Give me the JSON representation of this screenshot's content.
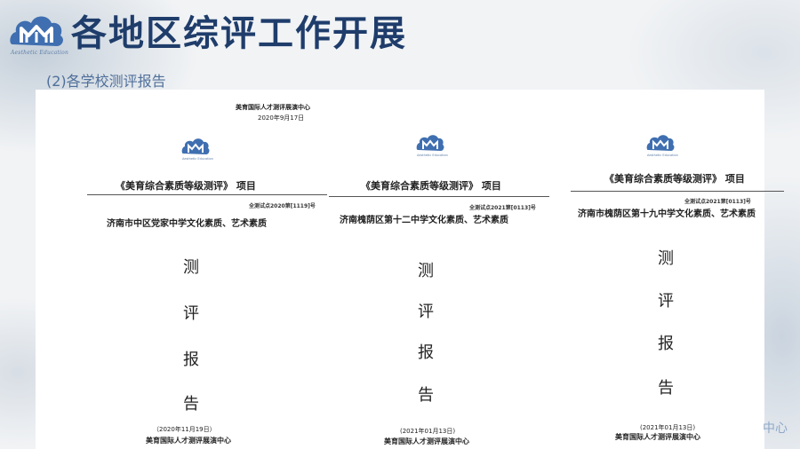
{
  "header": {
    "logo_text": "Aesthetic Education",
    "title": "各地区综评工作开展",
    "subtitle": "(2)各学校测评报告"
  },
  "corner_text": "中心",
  "reports": [
    {
      "top_org": "美育国际人才测评展演中心",
      "top_date": "2020年9月17日",
      "logo_text": "Aesthetic Education",
      "project": "《美育综合素质等级测评》 项目",
      "serial": "全测试点2020第[1119]号",
      "school": "济南市中区党家中学文化素质、艺术素质",
      "chars": [
        "测",
        "评",
        "报",
        "告"
      ],
      "date": "（2020年11月19日）",
      "issuer": "美育国际人才测评展演中心"
    },
    {
      "logo_text": "Aesthetic Education",
      "project": "《美育综合素质等级测评》 项目",
      "serial": "全测试点2021第[0113]号",
      "school": "济南槐荫区第十二中学文化素质、艺术素质",
      "chars": [
        "测",
        "评",
        "报",
        "告"
      ],
      "date": "(2021年01月13日)",
      "issuer": "美育国际人才测评展演中心"
    },
    {
      "logo_text": "Aesthetic Education",
      "project": "《美育综合素质等级测评》 项目",
      "serial": "全测试点2021第[0113]号",
      "school": "济南市槐荫区第十九中学文化素质、艺术素质",
      "chars": [
        "测",
        "评",
        "报",
        "告"
      ],
      "date": "(2021年01月13日)",
      "issuer": "美育国际人才测评展演中心"
    }
  ]
}
